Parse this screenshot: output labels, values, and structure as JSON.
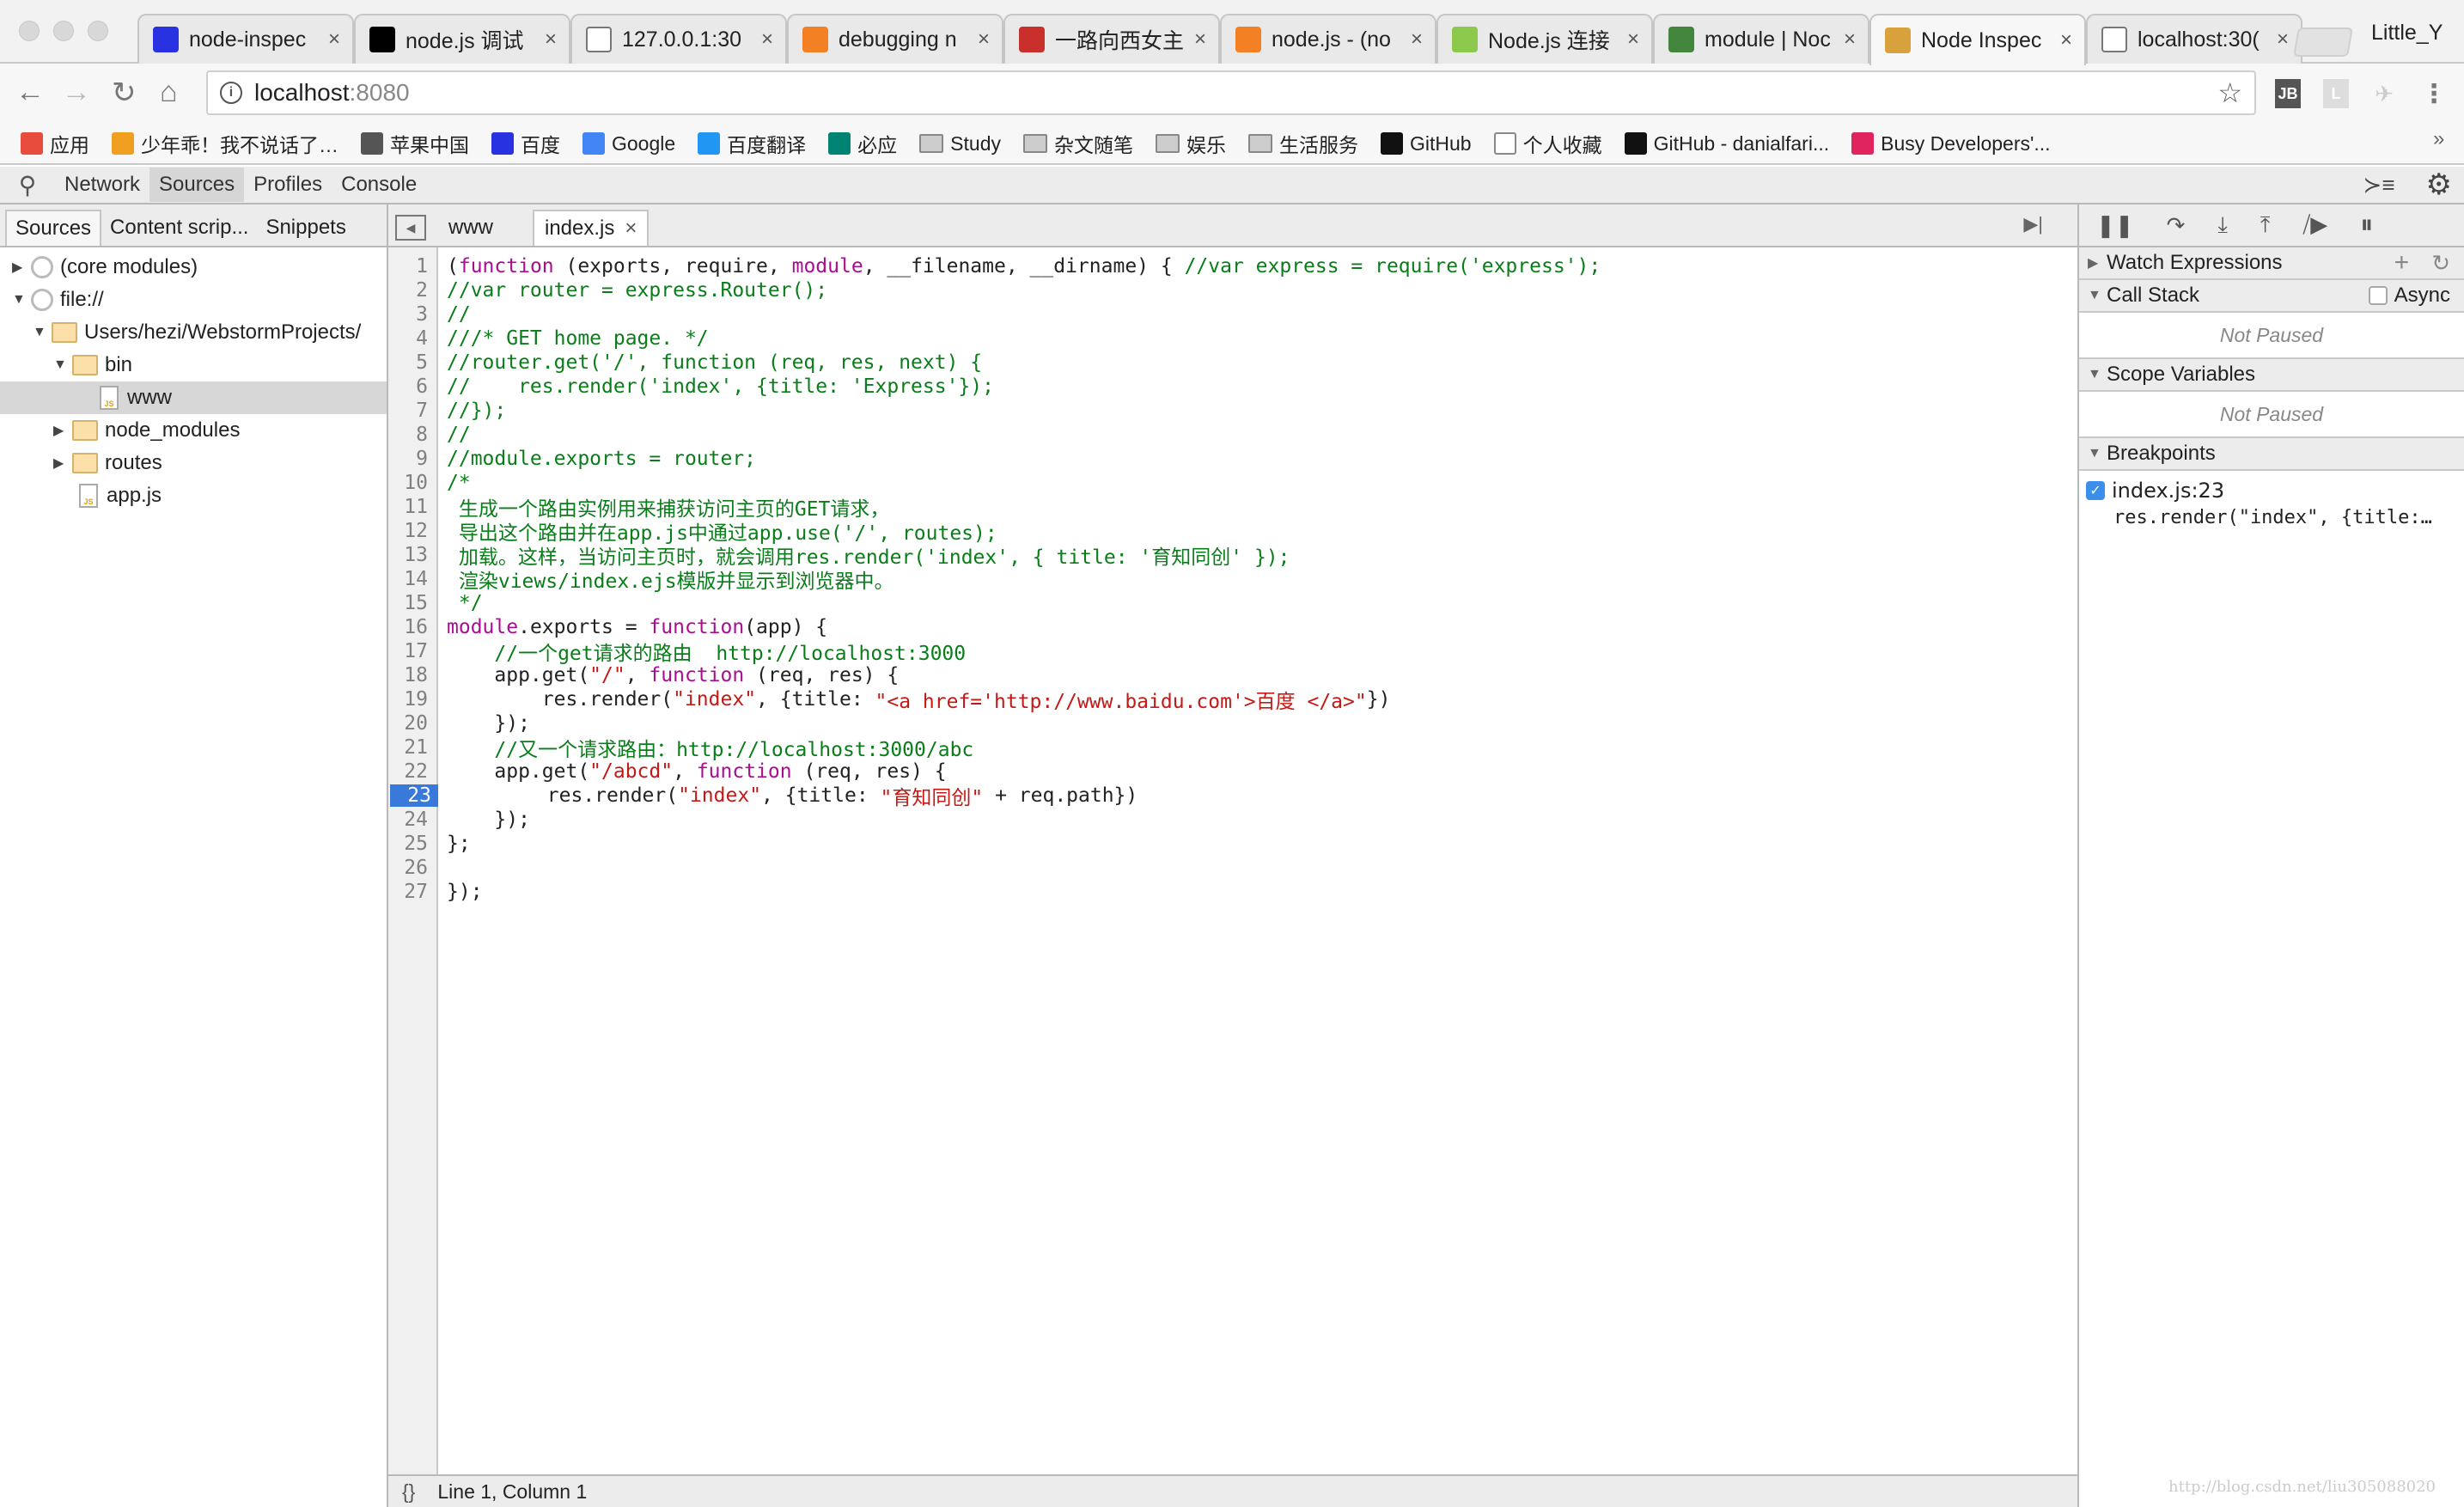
{
  "browser": {
    "tabs": [
      {
        "title": "node-inspec",
        "icon": "baidu-paw-icon",
        "color": "#2932e1"
      },
      {
        "title": "node.js 调试",
        "icon": "braces-icon",
        "color": "#000000"
      },
      {
        "title": "127.0.0.1:30",
        "icon": "page-icon",
        "color": "#ffffff"
      },
      {
        "title": "debugging n",
        "icon": "stackoverflow-icon",
        "color": "#f48024"
      },
      {
        "title": "一路向西女主",
        "icon": "csdn-icon",
        "color": "#c9302c"
      },
      {
        "title": "node.js - (no",
        "icon": "stackoverflow-icon",
        "color": "#f48024"
      },
      {
        "title": "Node.js 连接",
        "icon": "code-icon",
        "color": "#8cc84b"
      },
      {
        "title": "module | Noc",
        "icon": "nodejs-hexagon-icon",
        "color": "#43853d"
      },
      {
        "title": "Node Inspec",
        "icon": "tomcat-icon",
        "color": "#d9a13b",
        "active": true
      },
      {
        "title": "localhost:30(",
        "icon": "page-icon",
        "color": "#ffffff"
      }
    ],
    "profile": "Little_Y",
    "url_host": "localhost",
    "url_port": ":8080",
    "extensions": [
      "JB",
      "L"
    ],
    "bookmarks": [
      {
        "label": "应用",
        "icon": "apps-grid-icon",
        "color": "#e74c3c"
      },
      {
        "label": "少年乖！我不说话了…",
        "icon": "avatar-icon",
        "color": "#f0a020"
      },
      {
        "label": "苹果中国",
        "icon": "apple-icon",
        "color": "#555555"
      },
      {
        "label": "百度",
        "icon": "baidu-paw-icon",
        "color": "#2932e1"
      },
      {
        "label": "Google",
        "icon": "google-icon",
        "color": "#4285f4"
      },
      {
        "label": "百度翻译",
        "icon": "translate-icon",
        "color": "#2196f3"
      },
      {
        "label": "必应",
        "icon": "bing-icon",
        "color": "#008373"
      },
      {
        "label": "Study",
        "icon": "folder-icon"
      },
      {
        "label": "杂文随笔",
        "icon": "folder-icon"
      },
      {
        "label": "娱乐",
        "icon": "folder-icon"
      },
      {
        "label": "生活服务",
        "icon": "folder-icon"
      },
      {
        "label": "GitHub",
        "icon": "github-icon",
        "color": "#111111"
      },
      {
        "label": "个人收藏",
        "icon": "page-icon",
        "color": "#ffffff"
      },
      {
        "label": "GitHub - danialfari...",
        "icon": "github-icon",
        "color": "#111111"
      },
      {
        "label": "Busy Developers'...",
        "icon": "pen-icon",
        "color": "#e0245e"
      }
    ],
    "bookmarks_more": "»"
  },
  "devtools": {
    "panels": [
      "Network",
      "Sources",
      "Profiles",
      "Console"
    ],
    "selected_panel": "Sources",
    "navigator_tabs": [
      "Sources",
      "Content scrip...",
      "Snippets"
    ],
    "tree": [
      {
        "label": "(core modules)",
        "depth": 0,
        "type": "origin",
        "arrow": "▶"
      },
      {
        "label": "file://",
        "depth": 0,
        "type": "origin",
        "arrow": "▼"
      },
      {
        "label": "Users/hezi/WebstormProjects/",
        "depth": 1,
        "type": "folder",
        "arrow": "▼"
      },
      {
        "label": "bin",
        "depth": 2,
        "type": "folder",
        "arrow": "▼"
      },
      {
        "label": "www",
        "depth": 3,
        "type": "file",
        "arrow": "",
        "selected": true
      },
      {
        "label": "node_modules",
        "depth": 2,
        "type": "folder",
        "arrow": "▶"
      },
      {
        "label": "routes",
        "depth": 2,
        "type": "folder",
        "arrow": "▶"
      },
      {
        "label": "app.js",
        "depth": 2,
        "type": "file",
        "arrow": ""
      }
    ],
    "editor_tabs": [
      {
        "label": "www"
      },
      {
        "label": "index.js",
        "active": true,
        "close": "×"
      }
    ],
    "breakpoint_line": 23,
    "code": [
      [
        [
          "pl",
          "("
        ],
        [
          "kw",
          "function"
        ],
        [
          "pl",
          " (exports, require, "
        ],
        [
          "kw",
          "module"
        ],
        [
          "pl",
          ", __filename, __dirname) { "
        ],
        [
          "cm",
          "//var express = require('express');"
        ]
      ],
      [
        [
          "cm",
          "//var router = express.Router();"
        ]
      ],
      [
        [
          "cm",
          "//"
        ]
      ],
      [
        [
          "cm",
          "///* GET home page. */"
        ]
      ],
      [
        [
          "cm",
          "//router.get('/', function (req, res, next) {"
        ]
      ],
      [
        [
          "cm",
          "//    res.render('index', {title: 'Express'});"
        ]
      ],
      [
        [
          "cm",
          "//});"
        ]
      ],
      [
        [
          "cm",
          "//"
        ]
      ],
      [
        [
          "cm",
          "//module.exports = router;"
        ]
      ],
      [
        [
          "cm",
          "/*"
        ]
      ],
      [
        [
          "cm",
          " 生成一个路由实例用来捕获访问主页的GET请求，"
        ]
      ],
      [
        [
          "cm",
          " 导出这个路由并在app.js中通过app.use('/', routes);"
        ]
      ],
      [
        [
          "cm",
          " 加载。这样，当访问主页时，就会调用res.render('index', { title: '育知同创' });"
        ]
      ],
      [
        [
          "cm",
          " 渲染views/index.ejs模版并显示到浏览器中。"
        ]
      ],
      [
        [
          "cm",
          " */"
        ]
      ],
      [
        [
          "kw",
          "module"
        ],
        [
          "pl",
          ".exports = "
        ],
        [
          "kw",
          "function"
        ],
        [
          "pl",
          "(app) {"
        ]
      ],
      [
        [
          "pl",
          "    "
        ],
        [
          "cm",
          "//一个get请求的路由  http://localhost:3000"
        ]
      ],
      [
        [
          "pl",
          "    app.get("
        ],
        [
          "st",
          "\"/\""
        ],
        [
          "pl",
          ", "
        ],
        [
          "kw",
          "function"
        ],
        [
          "pl",
          " (req, res) {"
        ]
      ],
      [
        [
          "pl",
          "        res.render("
        ],
        [
          "st",
          "\"index\""
        ],
        [
          "pl",
          ", {title: "
        ],
        [
          "st",
          "\"<a href='http://www.baidu.com'>百度 </a>\""
        ],
        [
          "pl",
          "})"
        ]
      ],
      [
        [
          "pl",
          "    });"
        ]
      ],
      [
        [
          "pl",
          "    "
        ],
        [
          "cm",
          "//又一个请求路由：http://localhost:3000/abc"
        ]
      ],
      [
        [
          "pl",
          "    app.get("
        ],
        [
          "st",
          "\"/abcd\""
        ],
        [
          "pl",
          ", "
        ],
        [
          "kw",
          "function"
        ],
        [
          "pl",
          " (req, res) {"
        ]
      ],
      [
        [
          "pl",
          "        res.render("
        ],
        [
          "st",
          "\"index\""
        ],
        [
          "pl",
          ", {title: "
        ],
        [
          "st",
          "\"育知同创\""
        ],
        [
          "pl",
          " + req.path})"
        ]
      ],
      [
        [
          "pl",
          "    });"
        ]
      ],
      [
        [
          "pl",
          "};"
        ]
      ],
      [],
      [
        [
          "pl",
          "});"
        ]
      ]
    ],
    "status": {
      "braces": "{}",
      "position": "Line 1, Column 1"
    },
    "sidebar": {
      "watch": "Watch Expressions",
      "call_stack": "Call Stack",
      "async": "Async",
      "async_checked": false,
      "not_paused_1": "Not Paused",
      "scope": "Scope Variables",
      "not_paused_2": "Not Paused",
      "breakpoints": "Breakpoints",
      "breakpoint_items": [
        {
          "location": "index.js:23",
          "snippet": "res.render(\"index\", {title:…",
          "checked": true
        }
      ]
    }
  },
  "watermark": "http://blog.csdn.net/liu305088020"
}
